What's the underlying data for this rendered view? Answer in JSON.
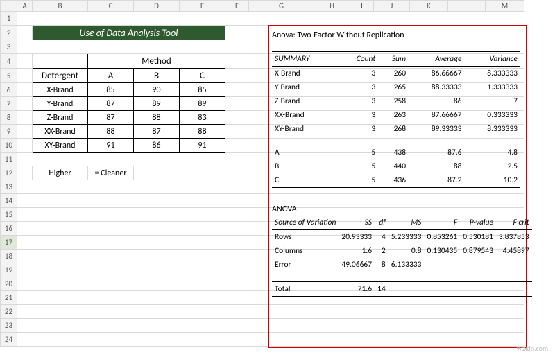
{
  "title": "Use of Data Analysis Tool",
  "columns": [
    "A",
    "B",
    "C",
    "D",
    "E",
    "F",
    "G",
    "H",
    "I",
    "J",
    "K",
    "L",
    "M"
  ],
  "left_table": {
    "method_header": "Method",
    "detergent_header": "Detergent",
    "cols": [
      "A",
      "B",
      "C"
    ],
    "rows": [
      {
        "name": "X-Brand",
        "v": [
          85,
          90,
          85
        ]
      },
      {
        "name": "Y-Brand",
        "v": [
          87,
          89,
          89
        ]
      },
      {
        "name": "Z-Brand",
        "v": [
          87,
          88,
          83
        ]
      },
      {
        "name": "XX-Brand",
        "v": [
          88,
          87,
          88
        ]
      },
      {
        "name": "XY-Brand",
        "v": [
          91,
          86,
          91
        ]
      }
    ]
  },
  "legend": {
    "higher": "Higher",
    "cleaner": "= Cleaner"
  },
  "anova": {
    "title": "Anova: Two-Factor Without Replication",
    "summary_label": "SUMMARY",
    "summary_headers": [
      "Count",
      "Sum",
      "Average",
      "Variance"
    ],
    "summary_rows": [
      {
        "name": "X-Brand",
        "count": 3,
        "sum": 260,
        "avg": "86.66667",
        "var": "8.333333"
      },
      {
        "name": "Y-Brand",
        "count": 3,
        "sum": 265,
        "avg": "88.33333",
        "var": "1.333333"
      },
      {
        "name": "Z-Brand",
        "count": 3,
        "sum": 258,
        "avg": "86",
        "var": "7"
      },
      {
        "name": "XX-Brand",
        "count": 3,
        "sum": 263,
        "avg": "87.66667",
        "var": "0.333333"
      },
      {
        "name": "XY-Brand",
        "count": 3,
        "sum": 268,
        "avg": "89.33333",
        "var": "8.333333"
      }
    ],
    "summary_cols": [
      {
        "name": "A",
        "count": 5,
        "sum": 438,
        "avg": "87.6",
        "var": "4.8"
      },
      {
        "name": "B",
        "count": 5,
        "sum": 440,
        "avg": "88",
        "var": "2.5"
      },
      {
        "name": "C",
        "count": 5,
        "sum": 436,
        "avg": "87.2",
        "var": "10.2"
      }
    ],
    "anova_label": "ANOVA",
    "anova_headers": [
      "Source of Variation",
      "SS",
      "df",
      "MS",
      "F",
      "P-value",
      "F crit"
    ],
    "anova_rows": [
      {
        "src": "Rows",
        "ss": "20.93333",
        "df": 4,
        "ms": "5.233333",
        "f": "0.853261",
        "p": "0.530181",
        "fc": "3.837853"
      },
      {
        "src": "Columns",
        "ss": "1.6",
        "df": 2,
        "ms": "0.8",
        "f": "0.130435",
        "p": "0.879543",
        "fc": "4.45897"
      },
      {
        "src": "Error",
        "ss": "49.06667",
        "df": 8,
        "ms": "6.133333",
        "f": "",
        "p": "",
        "fc": ""
      }
    ],
    "total": {
      "src": "Total",
      "ss": "71.6",
      "df": 14
    }
  },
  "watermark": "wsxdn.com",
  "selected_row": 17
}
